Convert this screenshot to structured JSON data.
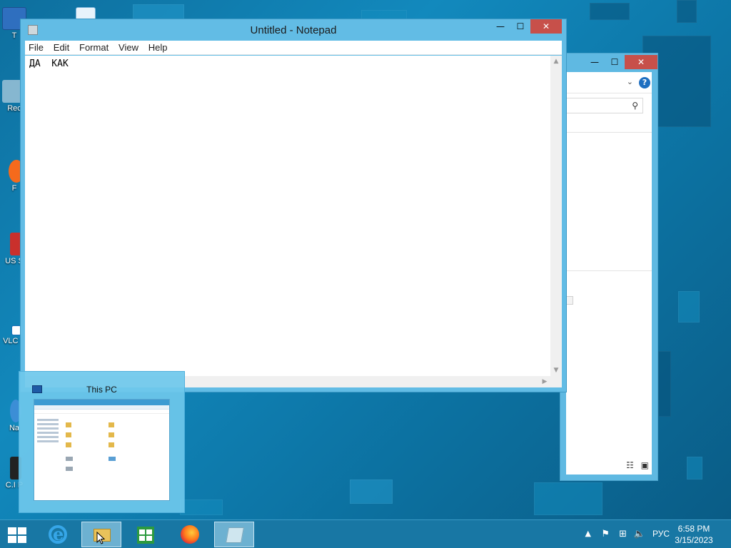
{
  "desktop": {
    "icons": [
      {
        "label": "T",
        "icon": "this-pc-icon"
      },
      {
        "label": "Rec",
        "icon": "recycle-bin-icon"
      },
      {
        "label": "F",
        "icon": "firefox-shortcut-icon"
      },
      {
        "label": "US S",
        "icon": "app-shortcut-icon"
      },
      {
        "label": "VLC P",
        "icon": "vlc-shortcut-icon"
      },
      {
        "label": "Na",
        "icon": "app-shortcut-icon"
      },
      {
        "label": "C.I P",
        "icon": "app-shortcut-icon"
      }
    ]
  },
  "notepad": {
    "title": "Untitled - Notepad",
    "menu": [
      "File",
      "Edit",
      "Format",
      "View",
      "Help"
    ],
    "content": "ДА  КАК",
    "controls": {
      "minimize": "—",
      "maximize": "☐",
      "close": "✕"
    }
  },
  "explorer": {
    "controls": {
      "minimize": "—",
      "maximize": "☐",
      "close": "✕"
    },
    "help": "?"
  },
  "thumbnail": {
    "title": "This PC"
  },
  "taskbar": {
    "apps": [
      {
        "name": "Internet Explorer",
        "icon": "ie-icon"
      },
      {
        "name": "File Explorer",
        "icon": "folder-icon"
      },
      {
        "name": "Store",
        "icon": "store-icon"
      },
      {
        "name": "Firefox",
        "icon": "firefox-icon"
      },
      {
        "name": "Notepad",
        "icon": "notepad-icon"
      }
    ],
    "tray": {
      "language": "РУС",
      "time": "6:58 PM",
      "date": "3/15/2023"
    }
  },
  "colors": {
    "accent": "#62bce5",
    "close": "#c7504a",
    "taskbar": "#1978a5"
  }
}
